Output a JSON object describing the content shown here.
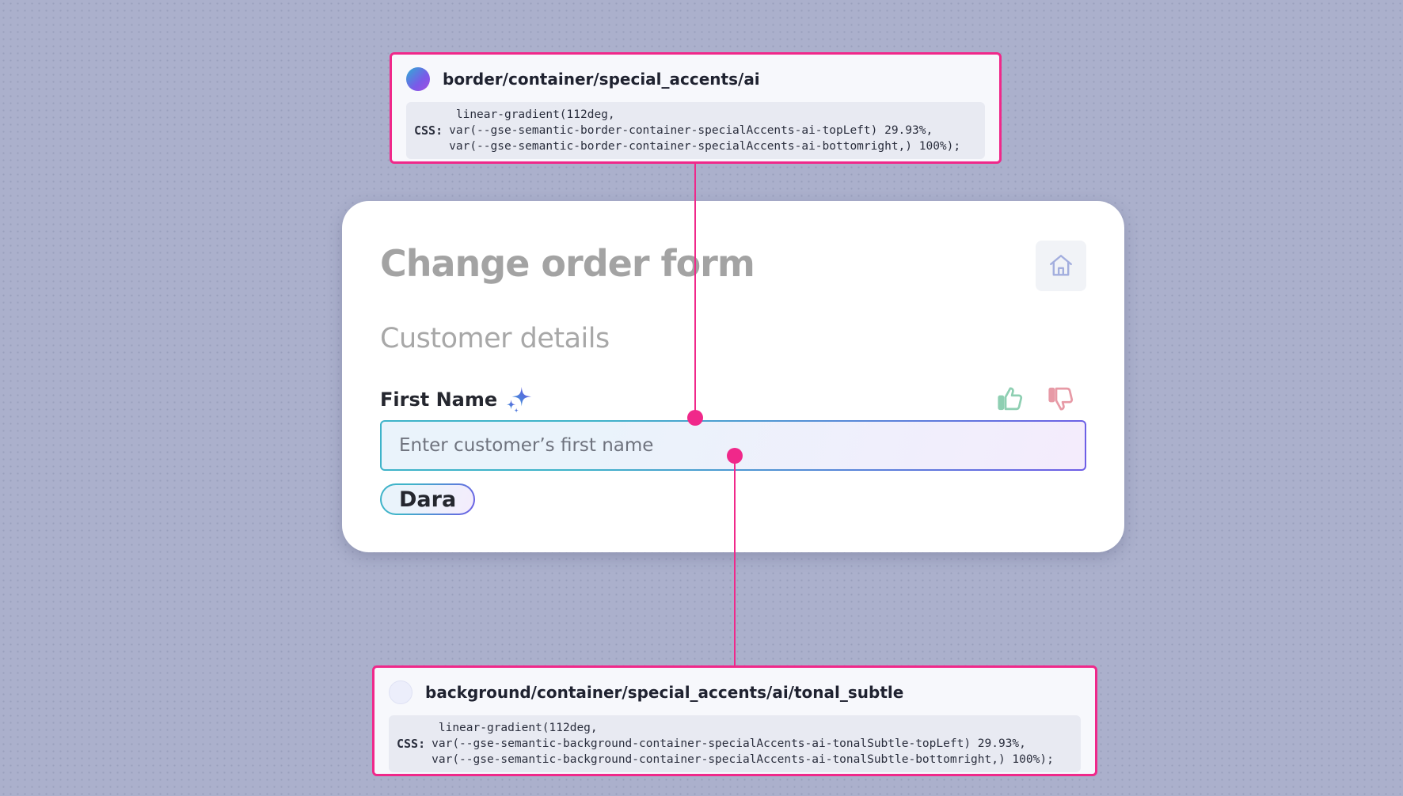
{
  "form": {
    "title": "Change order form",
    "section_heading": "Customer details",
    "first_name": {
      "label": "First Name",
      "placeholder": "Enter customer’s first name",
      "value": "",
      "suggestion": "Dara"
    },
    "icons": {
      "home": "home-icon",
      "sparkle": "sparkle-icon",
      "thumbs_up": "thumbs-up-icon",
      "thumbs_down": "thumbs-down-icon"
    }
  },
  "annotations": [
    {
      "token": "border/container/special_accents/ai",
      "css_label": "CSS:",
      "css_code": " linear-gradient(112deg,\nvar(--gse-semantic-border-container-specialAccents-ai-topLeft) 29.93%,\nvar(--gse-semantic-border-container-specialAccents-ai-bottomright,) 100%);"
    },
    {
      "token": "background/container/special_accents/ai/tonal_subtle",
      "css_label": "CSS:",
      "css_code": " linear-gradient(112deg,\nvar(--gse-semantic-background-container-specialAccents-ai-tonalSubtle-topLeft) 29.93%,\nvar(--gse-semantic-background-container-specialAccents-ai-tonalSubtle-bottomright,) 100%);"
    }
  ],
  "colors": {
    "canvas_background": "#abb0cc",
    "annotation_accent": "#f0288a",
    "ai_gradient_start": "#3fb3c9",
    "ai_gradient_end": "#6e5de6",
    "ai_tonal_start": "#eaf3fb",
    "ai_tonal_end": "#f4ecfc",
    "thumbs_up": "#8ecfb2",
    "thumbs_down": "#e79aa6",
    "muted_text": "#a3a3a3"
  }
}
